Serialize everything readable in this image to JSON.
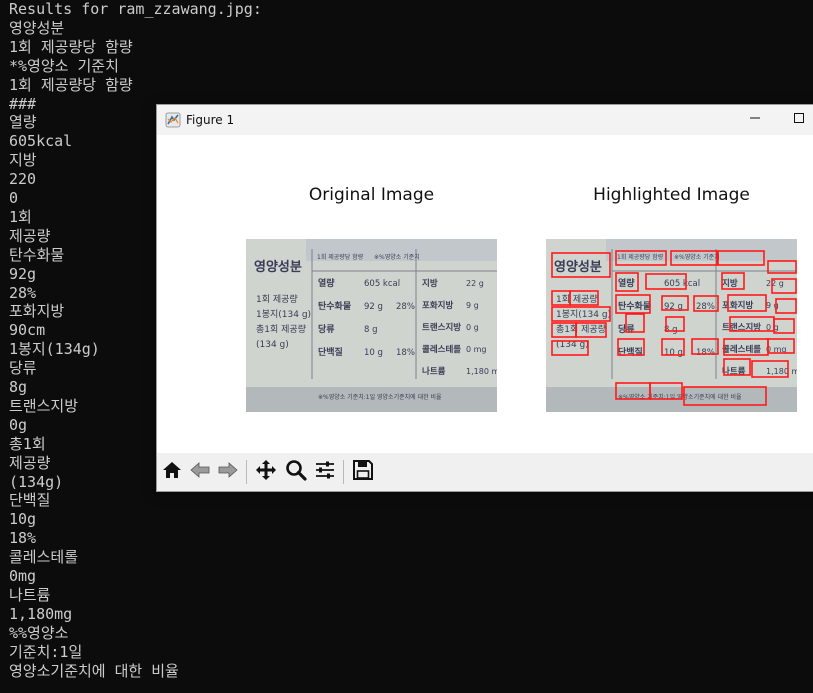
{
  "terminal": {
    "lines": [
      "Results for ram_zzawang.jpg:",
      "영양성분",
      "1회 제공량당 함량",
      "*%영양소 기준치",
      "1회 제공량당 함량",
      "###",
      "열량",
      "605kcal",
      "지방",
      "220",
      "0",
      "1회",
      "제공량",
      "탄수화물",
      "92g",
      "28%",
      "포화지방",
      "90cm",
      "1봉지(134g)",
      "당류",
      "8g",
      "트랜스지방",
      "0g",
      "총1회",
      "제공량",
      "(134g)",
      "단백질",
      "10g",
      "18%",
      "콜레스테롤",
      "0mg",
      "나트륨",
      "1,180mg",
      "%%영양소",
      "기준치:1일",
      "영양소기준치에 대한 비율"
    ]
  },
  "figure": {
    "window_title": "Figure 1",
    "original_title": "Original Image",
    "highlighted_title": "Highlighted Image",
    "toolbar_icons": [
      "home-icon",
      "back-icon",
      "forward-icon",
      "pan-icon",
      "zoom-icon",
      "configure-icon",
      "save-icon"
    ]
  },
  "label_photo": {
    "heading": "영양성분",
    "serving_header": "1회 제공량당 함량",
    "percent_header": "※%영양소 기준치",
    "serving_lines": [
      "1회 제공량",
      "1봉지(134 g)",
      "총1회 제공량",
      "(134 g)"
    ],
    "mid_rows": [
      {
        "name": "열량",
        "amount": "605 kcal",
        "pct": ""
      },
      {
        "name": "탄수화물",
        "amount": "92 g",
        "pct": "28%"
      },
      {
        "name": "당류",
        "amount": "8 g",
        "pct": ""
      },
      {
        "name": "단백질",
        "amount": "10 g",
        "pct": "18%"
      }
    ],
    "right_rows": [
      {
        "name": "지방",
        "amount": "22 g"
      },
      {
        "name": "포화지방",
        "amount": "9 g"
      },
      {
        "name": "트랜스지방",
        "amount": "0 g"
      },
      {
        "name": "콜레스테롤",
        "amount": "0 mg"
      },
      {
        "name": "나트륨",
        "amount": "1,180 mg"
      }
    ],
    "footer": "※%영양소 기준치:1일 영양소기준치에 대한 비율"
  },
  "colors": {
    "terminal_bg": "#0c0c0c",
    "terminal_fg": "#cccccc",
    "label_bg": "#cfd4cf",
    "label_text": "#3a3d55",
    "highlight": "#ff1a1a"
  }
}
